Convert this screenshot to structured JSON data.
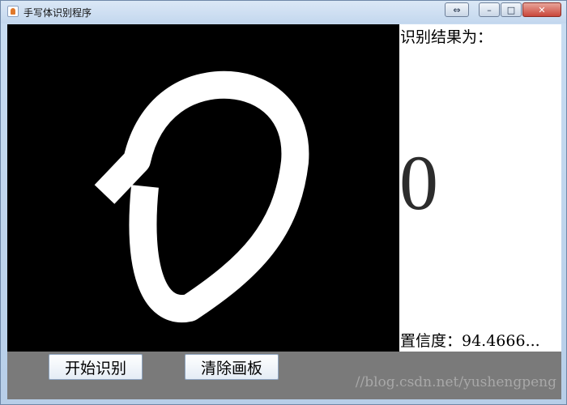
{
  "window": {
    "title": "手写体识别程序",
    "controls": {
      "restore_glyph": "⇔",
      "minimize_glyph": "–",
      "maximize_glyph": "□",
      "close_glyph": "✕"
    }
  },
  "canvas": {
    "background": "#000000",
    "stroke_color": "#ffffff",
    "drawn_content": "handwritten digit stroke"
  },
  "result": {
    "label": "识别结果为：",
    "digit": "0",
    "confidence_label": "置信度：94.4666..."
  },
  "buttons": {
    "start_recognition": "开始识别",
    "clear_canvas": "清除画板"
  },
  "watermark": "//blog.csdn.net/yushengpeng",
  "colors": {
    "bottom_bar": "#7a7a7a",
    "result_panel": "#ffffff"
  }
}
